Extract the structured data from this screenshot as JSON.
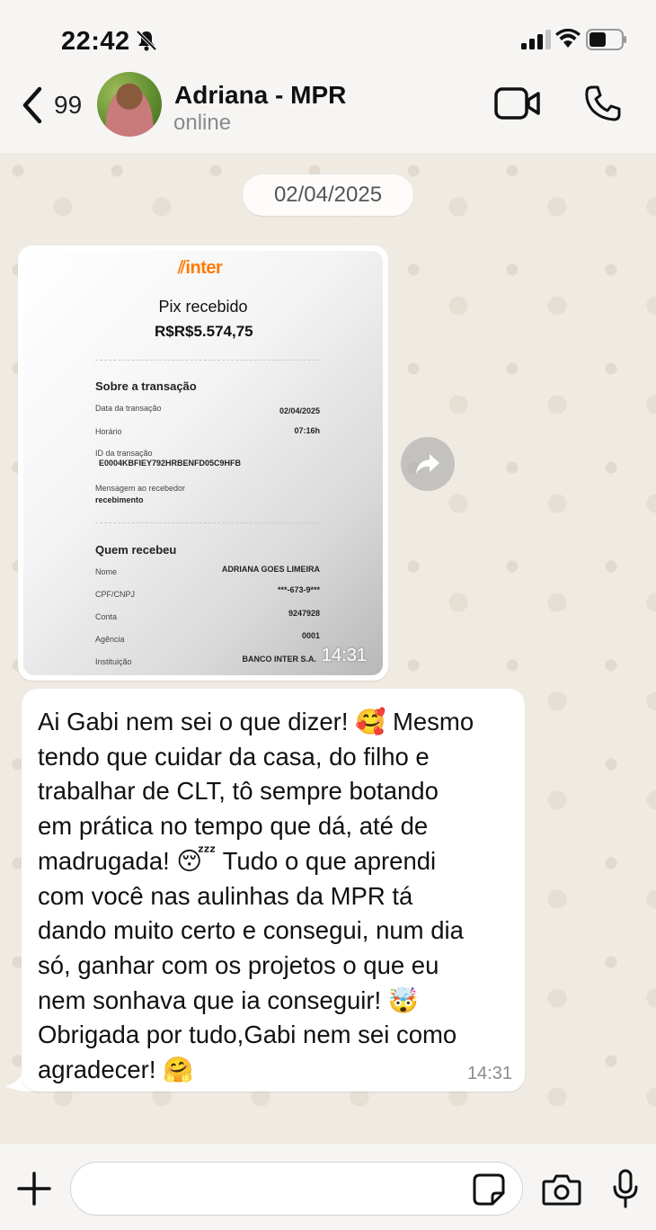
{
  "status_bar": {
    "time": "22:42"
  },
  "header": {
    "back_count": "99",
    "contact_name": "Adriana - MPR",
    "contact_status": "online"
  },
  "chat": {
    "date_label": "02/04/2025",
    "image_message": {
      "time": "14:31",
      "receipt": {
        "brand": "inter",
        "title": "Pix recebido",
        "amount": "R$R$5.574,75",
        "section_transaction": "Sobre a transação",
        "date_label": "Data da transação",
        "date_value": "02/04/2025",
        "time_label": "Horário",
        "time_value": "07:16h",
        "id_label": "ID da transação",
        "id_value": "E0004KBFIEY792HRBENFD05C9HFB",
        "message_label": "Mensagem ao recebedor",
        "message_value": "recebimento",
        "section_receiver": "Quem recebeu",
        "name_label": "Nome",
        "name_value": "ADRIANA  GOES LIMEIRA",
        "cpf_label": "CPF/CNPJ",
        "cpf_value": "***-673-9***",
        "account_label": "Conta",
        "account_value": "9247928",
        "agency_label": "Agência",
        "agency_value": "0001",
        "institution_label": "Instituição",
        "institution_value": "BANCO INTER S.A."
      }
    },
    "text_message": {
      "time": "14:31",
      "lines": [
        "Ai Gabi nem sei o que dizer! 🥰 Mesmo",
        "tendo que cuidar da casa, do filho e",
        "trabalhar de CLT, tô sempre botando",
        "em prática no tempo que dá, até de",
        "madrugada! 😴 Tudo o que aprendi",
        "com você nas aulinhas da MPR tá",
        "dando muito certo e consegui, num dia",
        "só, ganhar com os projetos o que eu",
        "nem sonhava que ia conseguir! 🤯",
        "Obrigada por tudo,Gabi nem sei como",
        "agradecer! 🤗"
      ]
    }
  },
  "input_bar": {
    "value": "",
    "placeholder": ""
  },
  "colors": {
    "chat_bg": "#efeae2",
    "bubble": "#ffffff",
    "inter_orange": "#ff7a00"
  }
}
